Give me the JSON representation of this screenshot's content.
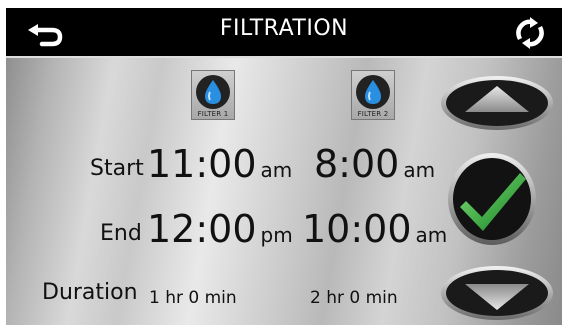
{
  "header": {
    "title": "FILTRATION",
    "back_icon": "back-arrow-icon",
    "refresh_icon": "refresh-icon"
  },
  "filters": [
    {
      "caption": "FILTER 1",
      "icon": "water-drop-icon"
    },
    {
      "caption": "FILTER 2",
      "icon": "water-drop-icon"
    }
  ],
  "labels": {
    "start": "Start",
    "end": "End",
    "duration": "Duration"
  },
  "filter1": {
    "start_time": "11:00",
    "start_ampm": "am",
    "end_time": "12:00",
    "end_ampm": "pm",
    "duration": "1 hr 0 min"
  },
  "filter2": {
    "start_time": "8:00",
    "start_ampm": "am",
    "end_time": "10:00",
    "end_ampm": "am",
    "duration": "2 hr 0 min"
  },
  "controls": {
    "up_icon": "up-arrow-icon",
    "confirm_icon": "checkmark-icon",
    "down_icon": "down-arrow-icon"
  },
  "colors": {
    "header_bg": "#000000",
    "header_text": "#ffffff",
    "check_green": "#1e9e2a",
    "drop_blue": "#2a8fe0"
  }
}
